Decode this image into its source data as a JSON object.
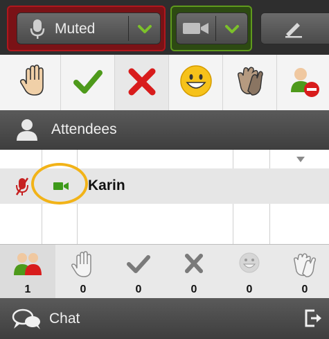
{
  "toolbar": {
    "mic_label": "Muted",
    "mic_icon": "microphone-icon",
    "camera_icon": "video-camera-icon",
    "edit_icon": "pencil-icon",
    "colors": {
      "muted_red": "#b0171d",
      "camera_green": "#5f9a1d",
      "check_green": "#7cc12a"
    }
  },
  "status_buttons": [
    {
      "name": "raise-hand",
      "icon": "hand-icon"
    },
    {
      "name": "agree",
      "icon": "checkmark-icon"
    },
    {
      "name": "disagree",
      "icon": "x-icon"
    },
    {
      "name": "smile",
      "icon": "smiley-icon"
    },
    {
      "name": "applause",
      "icon": "clap-icon"
    },
    {
      "name": "away",
      "icon": "user-away-icon"
    }
  ],
  "attendees": {
    "header": "Attendees",
    "rows": [
      {
        "name": "Karin",
        "mic": "muted",
        "camera": "on"
      }
    ]
  },
  "counts": [
    {
      "icon": "attendees-icon",
      "value": "1"
    },
    {
      "icon": "hand-icon",
      "value": "0"
    },
    {
      "icon": "checkmark-icon",
      "value": "0"
    },
    {
      "icon": "x-icon",
      "value": "0"
    },
    {
      "icon": "smiley-icon",
      "value": "0"
    },
    {
      "icon": "clap-icon",
      "value": "0"
    }
  ],
  "chat": {
    "label": "Chat"
  }
}
